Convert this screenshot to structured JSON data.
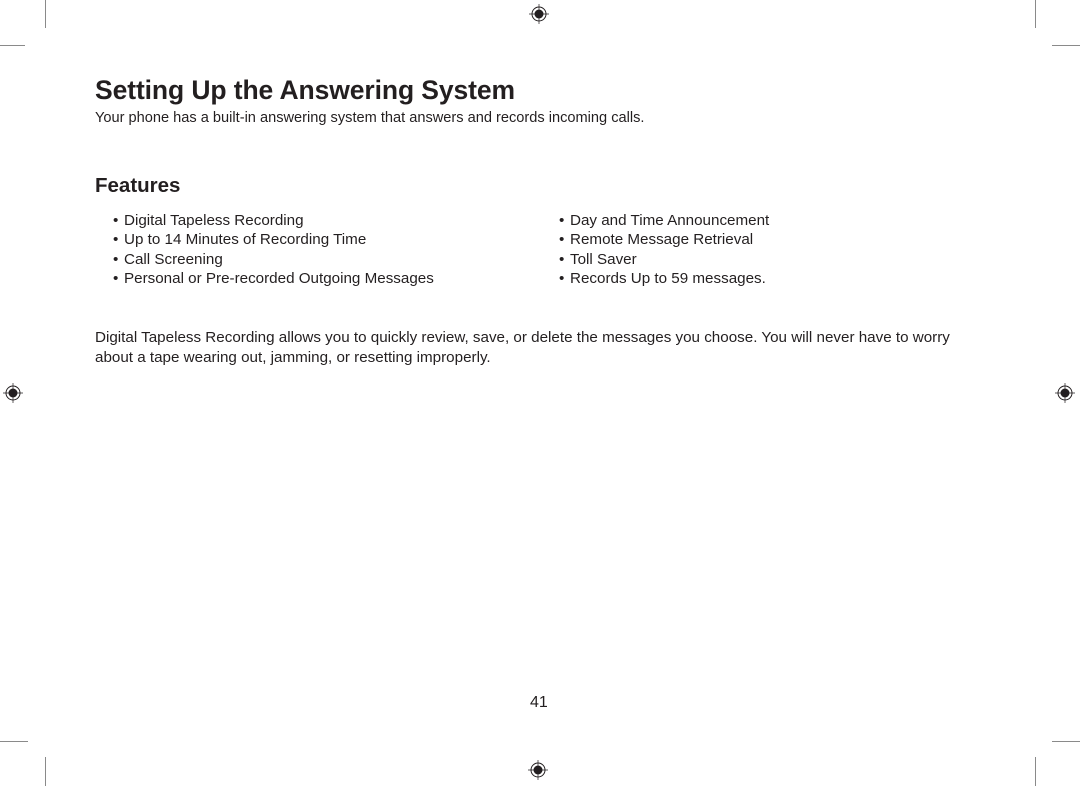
{
  "title": "Setting Up the Answering System",
  "intro": "Your phone has a built-in answering system that answers and records incoming calls.",
  "features": {
    "heading": "Features",
    "bullet_glyph": "•",
    "left_column": [
      "Digital Tapeless Recording",
      "Up to 14 Minutes of Recording Time",
      "Call Screening",
      "Personal or Pre-recorded Outgoing Messages"
    ],
    "right_column": [
      "Day and Time Announcement",
      "Remote Message Retrieval",
      "Toll Saver",
      "Records Up to 59 messages."
    ]
  },
  "body_paragraph": "Digital Tapeless Recording allows you to quickly review, save, or delete the messages you choose. You will never have to worry about a tape wearing out, jamming, or resetting improperly.",
  "page_number": "41",
  "print_marks": {
    "registration_mark_icon": "registration-target-icon",
    "crop_mark_color": "#8a8a8a"
  }
}
